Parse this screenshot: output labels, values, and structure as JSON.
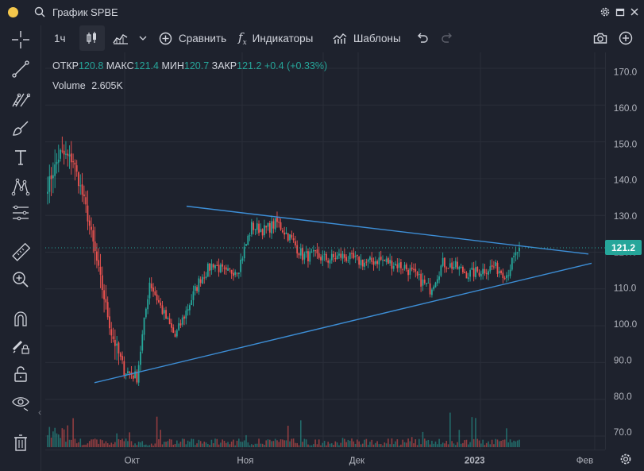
{
  "app": {
    "title": "График SPBE"
  },
  "toolbar": {
    "interval": "1ч",
    "compare_label": "Сравнить",
    "indicators_label": "Индикаторы",
    "templates_label": "Шаблоны"
  },
  "legend": {
    "open_label": "ОТКР",
    "open_value": "120.8",
    "high_label": "МАКС",
    "high_value": "121.4",
    "low_label": "МИН",
    "low_value": "120.7",
    "close_label": "ЗАКР",
    "close_value": "121.2",
    "change": "+0.4 (+0.33%)",
    "volume_label": "Volume",
    "volume_value": "2.605K"
  },
  "colors": {
    "up": "#26a69a",
    "down": "#ef5350",
    "trendline": "#3d8ed6",
    "background": "#1e222d",
    "accent_dot": "#f5c84c"
  },
  "icons": [
    "search-icon",
    "gear-icon",
    "restore-icon",
    "close-icon",
    "crosshair-icon",
    "trendline-icon",
    "pitchfork-icon",
    "brush-icon",
    "text-icon",
    "pattern-icon",
    "measure-icon",
    "ruler-icon",
    "zoom-in-icon",
    "magnet-icon",
    "lock-drawing-icon",
    "unlock-icon",
    "eye-icon",
    "trash-icon",
    "camera-icon",
    "add-icon",
    "undo-icon",
    "redo-icon",
    "candles-icon",
    "area-icon",
    "settings-icon"
  ],
  "chart_data": {
    "type": "candlestick",
    "symbol": "SPBE",
    "interval": "1ч",
    "last_price": "121.2",
    "y_ticks": [
      "170.0",
      "160.0",
      "150.0",
      "140.0",
      "130.0",
      "120.0",
      "110.0",
      "100.0",
      "90.0",
      "80.0",
      "70.0"
    ],
    "x_ticks": [
      "Окт",
      "Ноя",
      "Дек",
      "2023",
      "Фев"
    ],
    "ylim": [
      68,
      174
    ],
    "approx_close_path": [
      {
        "t": "late Sep",
        "v": 138
      },
      {
        "t": "late Sep",
        "v": 147
      },
      {
        "t": "late Sep",
        "v": 145
      },
      {
        "t": "late Sep",
        "v": 132
      },
      {
        "t": "late Sep",
        "v": 115
      },
      {
        "t": "late Sep",
        "v": 98
      },
      {
        "t": "early Oct",
        "v": 88
      },
      {
        "t": "early Oct",
        "v": 86
      },
      {
        "t": "Oct",
        "v": 112
      },
      {
        "t": "Oct",
        "v": 104
      },
      {
        "t": "Oct",
        "v": 97
      },
      {
        "t": "Oct",
        "v": 105
      },
      {
        "t": "Oct",
        "v": 113
      },
      {
        "t": "late Oct",
        "v": 117
      },
      {
        "t": "late Oct",
        "v": 114
      },
      {
        "t": "late Oct",
        "v": 116
      },
      {
        "t": "early Nov",
        "v": 127
      },
      {
        "t": "Nov",
        "v": 126
      },
      {
        "t": "Nov",
        "v": 128
      },
      {
        "t": "Nov",
        "v": 124
      },
      {
        "t": "Nov",
        "v": 119
      },
      {
        "t": "Nov",
        "v": 119
      },
      {
        "t": "Nov",
        "v": 118
      },
      {
        "t": "late Nov",
        "v": 119
      },
      {
        "t": "late Nov",
        "v": 118
      },
      {
        "t": "Dec",
        "v": 117
      },
      {
        "t": "Dec",
        "v": 118
      },
      {
        "t": "Dec",
        "v": 117
      },
      {
        "t": "Dec",
        "v": 116
      },
      {
        "t": "Dec",
        "v": 113
      },
      {
        "t": "mid Dec",
        "v": 110
      },
      {
        "t": "mid Dec",
        "v": 117
      },
      {
        "t": "late Dec",
        "v": 116
      },
      {
        "t": "late Dec",
        "v": 114
      },
      {
        "t": "2023",
        "v": 115
      },
      {
        "t": "Jan",
        "v": 116
      },
      {
        "t": "Jan",
        "v": 114
      },
      {
        "t": "Jan",
        "v": 121.2
      }
    ],
    "trendlines": [
      {
        "name": "upper",
        "from_price": 132.5,
        "to_price": 119.5
      },
      {
        "name": "lower",
        "from_price": 84.5,
        "to_price": 117
      }
    ]
  }
}
